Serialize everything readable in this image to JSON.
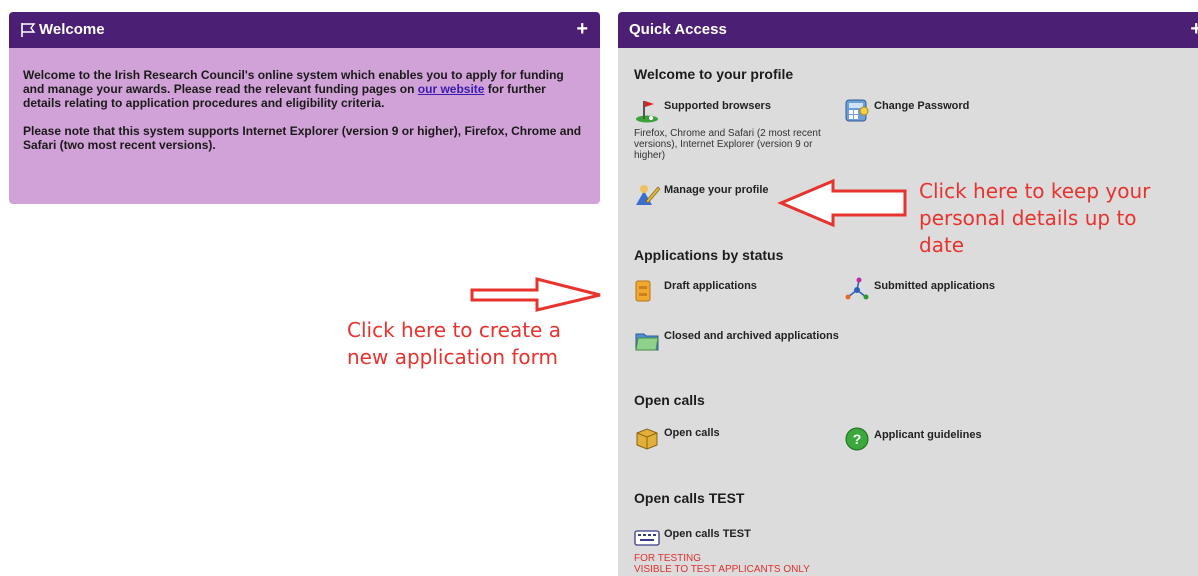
{
  "welcome": {
    "title": "Welcome",
    "para1_before": "Welcome to the Irish Research Council's online system which enables you to apply for funding and manage your awards. Please read the relevant funding pages on ",
    "para1_link": "our website",
    "para1_after": " for further details relating to application procedures and eligibility criteria.",
    "para2": "Please note that this system supports Internet Explorer (version 9 or higher), Firefox, Chrome and Safari (two most recent versions).",
    "plus": "+"
  },
  "quick_access": {
    "title": "Quick Access",
    "plus": "+",
    "sections": {
      "profile": "Welcome to your profile",
      "status": "Applications by status",
      "open_calls": "Open calls",
      "open_calls_test": "Open calls TEST"
    },
    "items": {
      "supported_browsers": "Supported browsers",
      "supported_browsers_desc": [
        "Firefox, Chrome and Safari (2 most recent",
        "versions), Internet Explorer (version 9 or",
        "higher)"
      ],
      "change_password": "Change Password",
      "manage_profile": "Manage your profile",
      "draft_apps": "Draft applications",
      "submitted_apps": "Submitted applications",
      "closed_apps": "Closed and archived applications",
      "open_calls": "Open calls",
      "applicant_guidelines": "Applicant guidelines",
      "open_calls_test": "Open calls TEST",
      "test_note": [
        "FOR TESTING",
        "VISIBLE TO TEST APPLICANTS ONLY"
      ]
    }
  },
  "annotations": {
    "profile_note": [
      "Click here to keep your",
      "personal details up to",
      "date"
    ],
    "create_note": [
      "Click here to create a",
      "new application form"
    ]
  },
  "colors": {
    "header": "#4a1f74",
    "welcome_bg": "#d1a2d7",
    "panel_bg": "#dcdcdc",
    "annotation_red": "#e8322e"
  }
}
